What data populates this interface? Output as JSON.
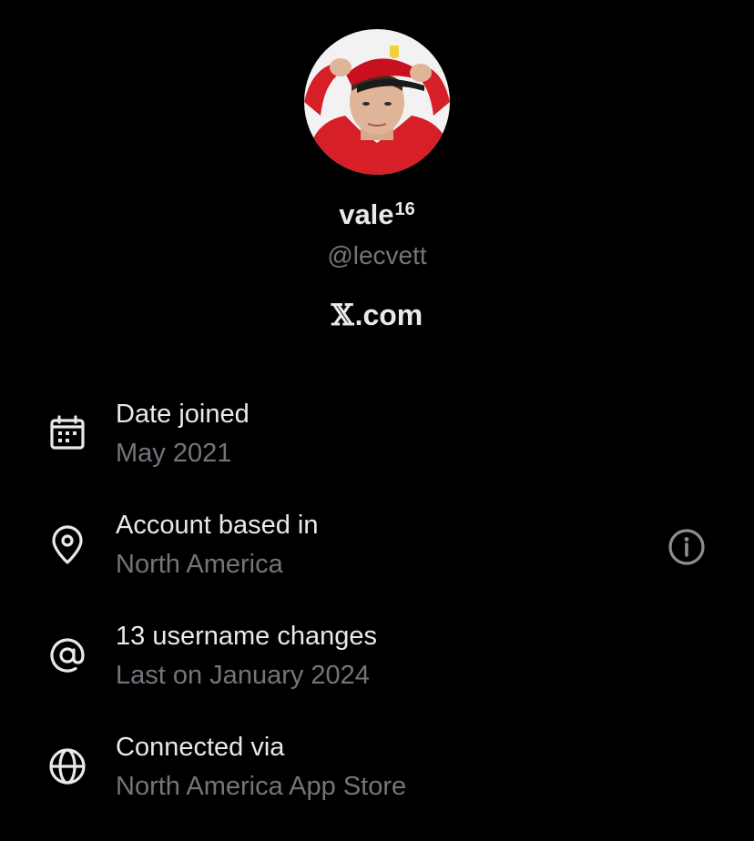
{
  "profile": {
    "display_name": "vale",
    "display_name_superscript": "16",
    "handle": "@lecvett",
    "platform_label": ".com",
    "platform_mark": "𝕏"
  },
  "details": [
    {
      "icon": "calendar-icon",
      "title": "Date joined",
      "subtitle": "May 2021"
    },
    {
      "icon": "location-pin-icon",
      "title": "Account based in",
      "subtitle": "North America"
    },
    {
      "icon": "at-sign-icon",
      "title": "13 username changes",
      "subtitle": "Last on January 2024"
    },
    {
      "icon": "globe-icon",
      "title": "Connected via",
      "subtitle": "North America App Store"
    }
  ],
  "colors": {
    "background": "#000000",
    "primary_text": "#e7e9ea",
    "secondary_text": "#71767b",
    "info_icon": "#8b8f94"
  }
}
